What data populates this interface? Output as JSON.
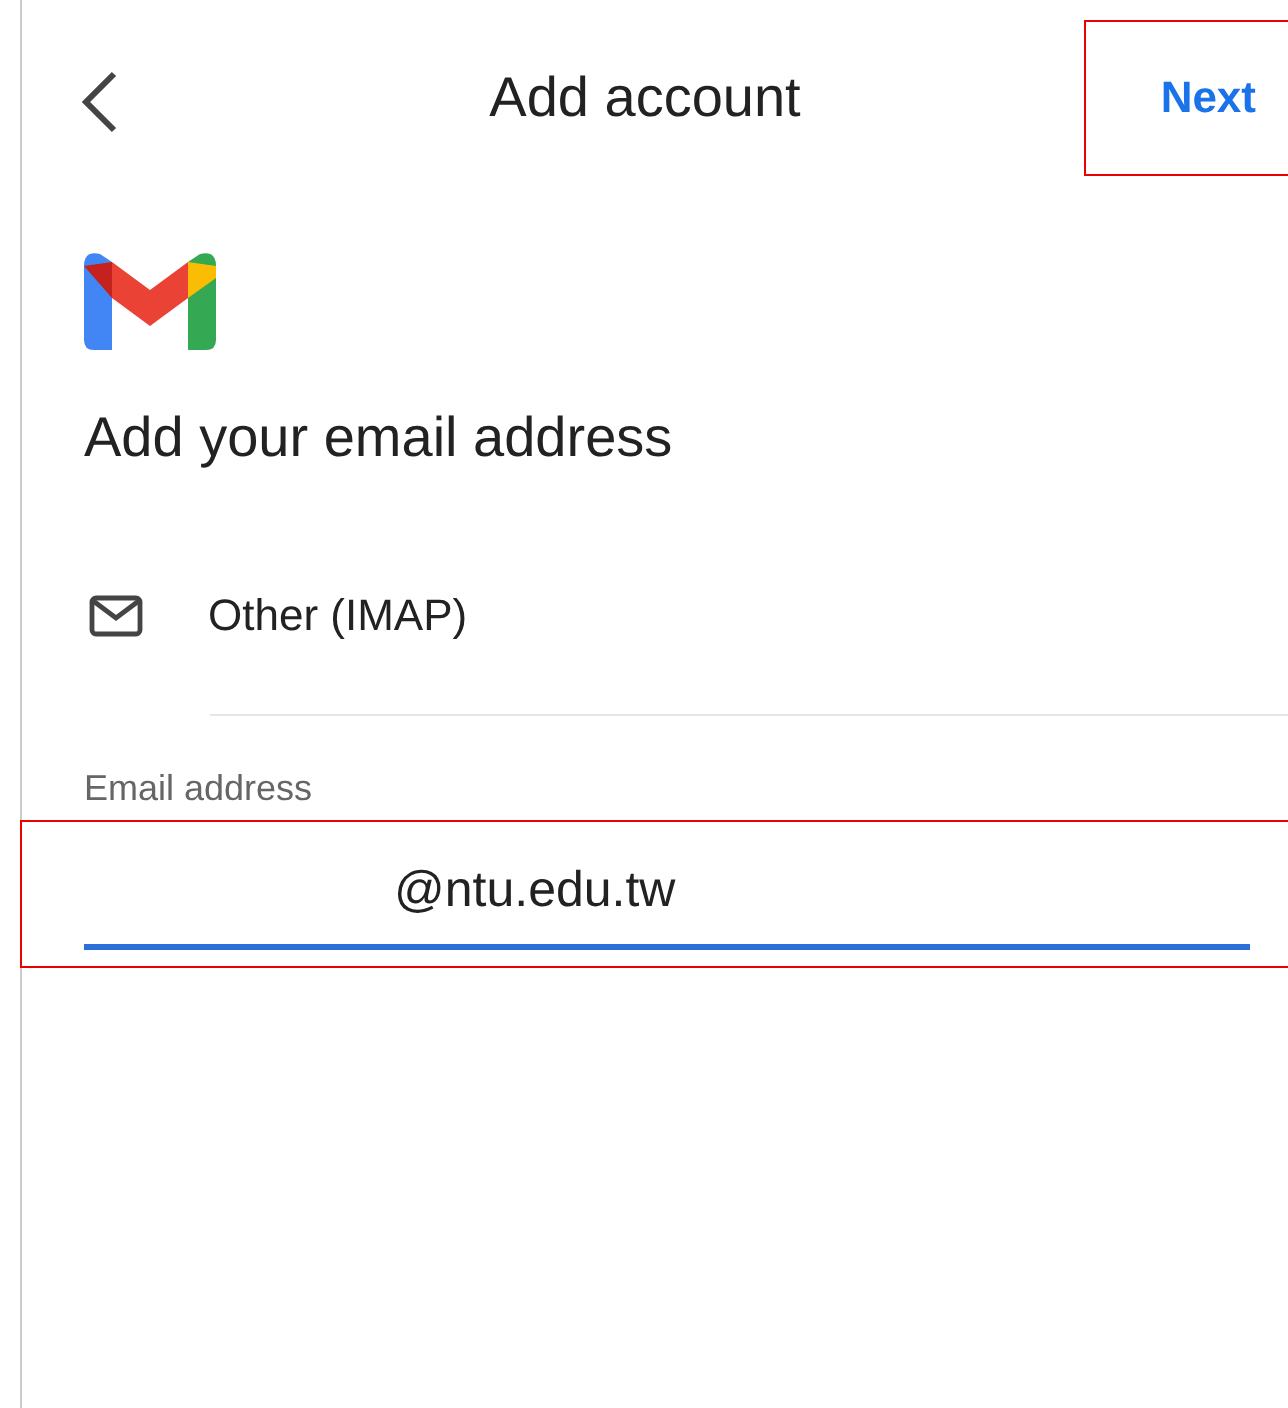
{
  "header": {
    "title": "Add account",
    "next": {
      "label": "Next",
      "highlighted": true
    }
  },
  "heading": "Add your email address",
  "account_type": {
    "label": "Other (IMAP)"
  },
  "email_field": {
    "label": "Email address",
    "value": "@ntu.edu.tw",
    "focused": true,
    "highlighted": true
  }
}
